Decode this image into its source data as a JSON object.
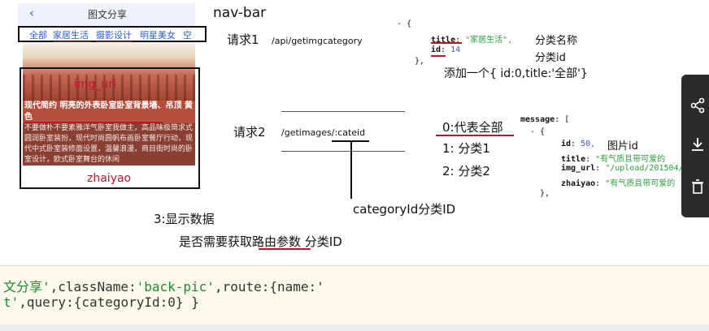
{
  "phone": {
    "back_icon": "chevron-left-icon",
    "title": "图文分享",
    "tabs": [
      "全部",
      "家居生活",
      "摄影设计",
      "明星美女",
      "空"
    ],
    "card_title": "现代简约 明亮的外表卧室卧室背景墙、吊顶 黄色",
    "card_body": "不要做朴不要素雅洋气卧室我做主，高品味极简求式圆润卧室装扮，现代时尚圆帆布画卧室餐厅行动，现代中式卧室装修面设置，温馨浪漫，商目街时尚的卧室设计，欧式卧室舞台的休闲",
    "img_url_label": "img_url",
    "zhaiyao_label": "zhaiyao"
  },
  "annotations": {
    "nav_bar": "nav-bar",
    "req1_label": "请求1",
    "req1_url": "/api/getimgcategory",
    "req2_label": "请求2",
    "req2_url": "/getimages/:cateid",
    "category_note": "分类名称",
    "id_note": "分类id",
    "add_all_note": "添加一个{ id:0,title:'全部'}",
    "zero_all": "0:代表全部",
    "one": "1: 分类1",
    "two": "2: 分类2",
    "pic_id": "图片id",
    "category_id": "categoryId分类ID",
    "step3": "3:显示数据",
    "route_q": "是否需要获取路由参数 分类ID"
  },
  "json1": {
    "open": "- {",
    "title_key": "title",
    "title_val": "\"家居生活\",",
    "id_key": "id",
    "id_val": "14",
    "close": "},"
  },
  "json2": {
    "message_key": "message",
    "open": "- {",
    "id_key": "id",
    "id_val": "50,",
    "title_key": "title",
    "title_val": "\"有气质且带可爱的",
    "imgurl_key": "img_url",
    "imgurl_val": "\"/upload/201504/1",
    "zhaiyao_key": "zhaiyao",
    "zhaiyao_val": "\"有气质且带可爱的",
    "close": "},"
  },
  "code": {
    "line1_a": "文分享'",
    "line1_b": ",className:",
    "line1_c": "'back-pic'",
    "line1_d": ",route:{name:'",
    "line2_a": "t'",
    "line2_b": ",query:{categoryId:0} }"
  },
  "side_panel": {
    "icons": [
      "share-icon",
      "download-icon",
      "delete-icon"
    ]
  }
}
